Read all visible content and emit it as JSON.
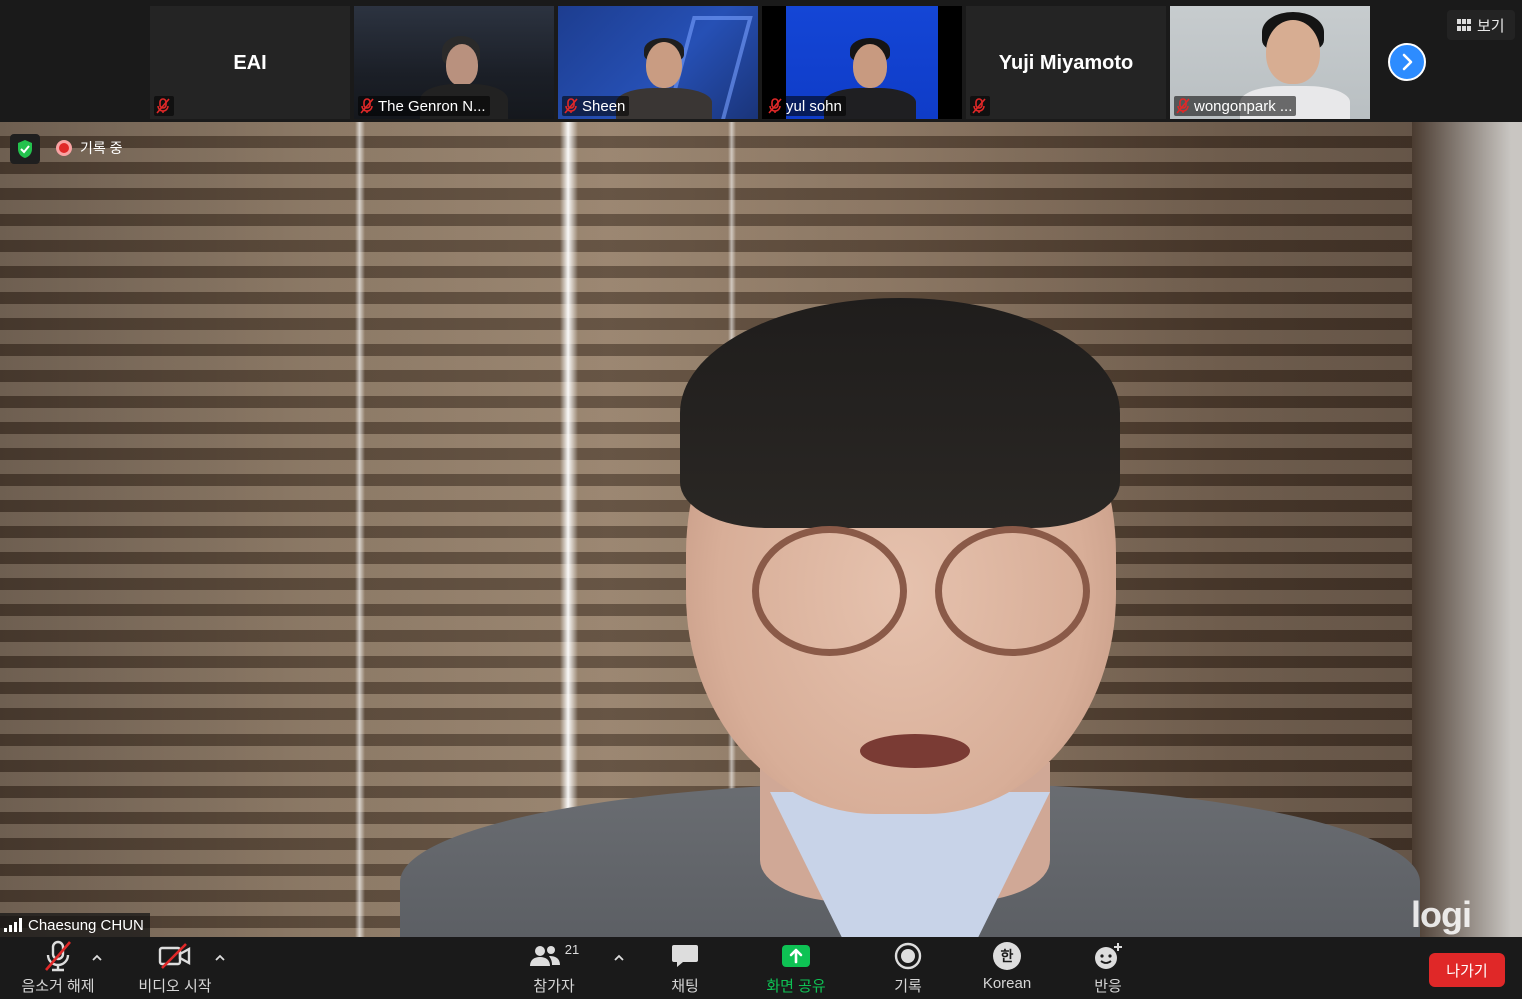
{
  "gallery": {
    "tiles": [
      {
        "name": "EAI",
        "label": ""
      },
      {
        "name": "",
        "label": "The Genron N..."
      },
      {
        "name": "",
        "label": "Sheen"
      },
      {
        "name": "",
        "label": "yul sohn"
      },
      {
        "name": "Yuji Miyamoto",
        "label": ""
      },
      {
        "name": "",
        "label": "wongonpark ..."
      }
    ],
    "view_label": "보기"
  },
  "main": {
    "recording_label": "기록 중",
    "speaker_name": "Chaesung CHUN",
    "camera_brand": "logi"
  },
  "toolbar": {
    "unmute_label": "음소거 해제",
    "start_video_label": "비디오 시작",
    "participants_label": "참가자",
    "participants_count": "21",
    "chat_label": "채팅",
    "share_label": "화면 공유",
    "record_label": "기록",
    "language_label": "Korean",
    "language_glyph": "한",
    "reactions_label": "반응",
    "leave_label": "나가기"
  },
  "colors": {
    "accent_blue": "#2d8cff",
    "share_green": "#0ec254",
    "leave_red": "#e02828",
    "muted_red": "#e02828"
  }
}
